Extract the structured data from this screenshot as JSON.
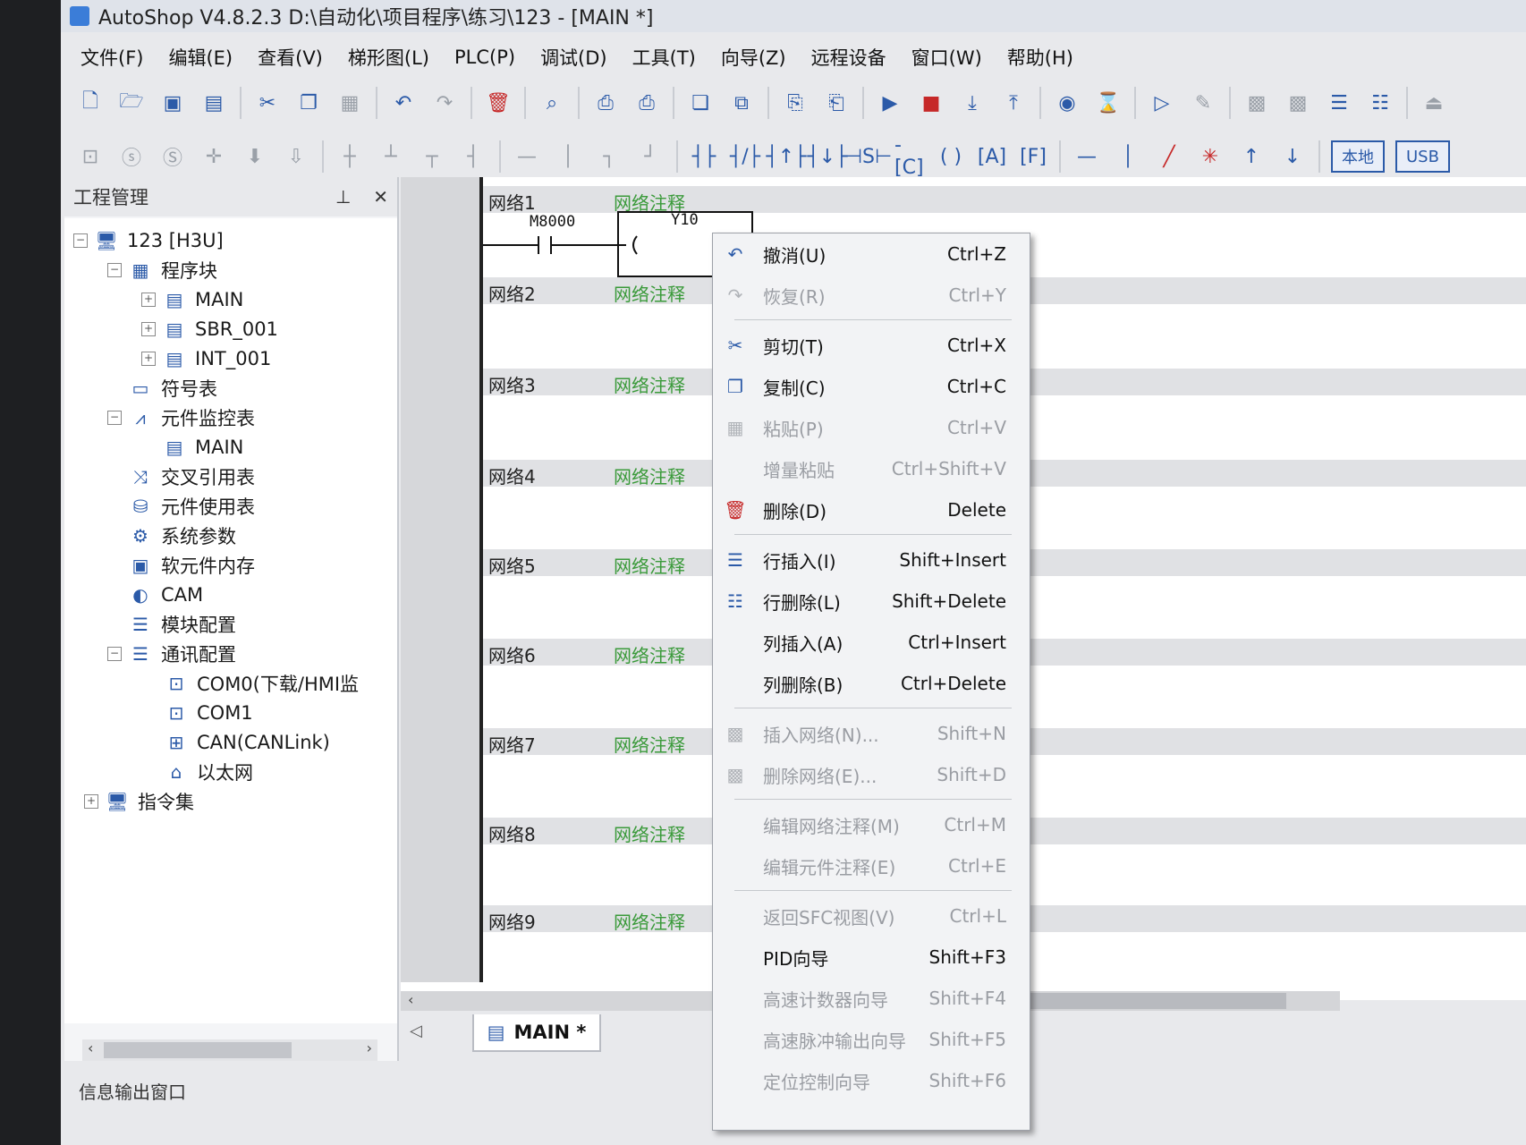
{
  "window": {
    "title": "AutoShop V4.8.2.3  D:\\自动化\\项目程序\\练习\\123 - [MAIN *]"
  },
  "menubar": [
    "文件(F)",
    "编辑(E)",
    "查看(V)",
    "梯形图(L)",
    "PLC(P)",
    "调试(D)",
    "工具(T)",
    "向导(Z)",
    "远程设备",
    "窗口(W)",
    "帮助(H)"
  ],
  "toolbar2_labels": {
    "local": "本地",
    "usb": "USB"
  },
  "project_panel": {
    "title": "工程管理",
    "tree": {
      "root": "123 [H3U]",
      "program_block": "程序块",
      "main": "MAIN",
      "sbr": "SBR_001",
      "int": "INT_001",
      "symbol_table": "符号表",
      "monitor_table": "元件监控表",
      "monitor_main": "MAIN",
      "cross_ref": "交叉引用表",
      "usage_table": "元件使用表",
      "sys_params": "系统参数",
      "soft_mem": "软元件内存",
      "cam": "CAM",
      "module_config": "模块配置",
      "comm_config": "通讯配置",
      "com0": "COM0(下载/HMI监",
      "com1": "COM1",
      "can": "CAN(CANLink)",
      "ethernet": "以太网",
      "instruction_set": "指令集"
    }
  },
  "info_window": "信息输出窗口",
  "ladder": {
    "networks": [
      "网络1",
      "网络2",
      "网络3",
      "网络4",
      "网络5",
      "网络6",
      "网络7",
      "网络8",
      "网络9"
    ],
    "comment": "网络注释",
    "contact": "M8000",
    "coil": "Y10"
  },
  "tab": {
    "label": "MAIN *"
  },
  "context_menu": [
    {
      "label": "撤消(U)",
      "key": "Ctrl+Z",
      "enabled": true
    },
    {
      "label": "恢复(R)",
      "key": "Ctrl+Y",
      "enabled": false
    },
    {
      "label": "剪切(T)",
      "key": "Ctrl+X",
      "enabled": true
    },
    {
      "label": "复制(C)",
      "key": "Ctrl+C",
      "enabled": true
    },
    {
      "label": "粘贴(P)",
      "key": "Ctrl+V",
      "enabled": false
    },
    {
      "label": "增量粘贴",
      "key": "Ctrl+Shift+V",
      "enabled": false
    },
    {
      "label": "删除(D)",
      "key": "Delete",
      "enabled": true
    },
    {
      "label": "行插入(I)",
      "key": "Shift+Insert",
      "enabled": true
    },
    {
      "label": "行删除(L)",
      "key": "Shift+Delete",
      "enabled": true
    },
    {
      "label": "列插入(A)",
      "key": "Ctrl+Insert",
      "enabled": true
    },
    {
      "label": "列删除(B)",
      "key": "Ctrl+Delete",
      "enabled": true
    },
    {
      "label": "插入网络(N)...",
      "key": "Shift+N",
      "enabled": false
    },
    {
      "label": "删除网络(E)...",
      "key": "Shift+D",
      "enabled": false
    },
    {
      "label": "编辑网络注释(M)",
      "key": "Ctrl+M",
      "enabled": false
    },
    {
      "label": "编辑元件注释(E)",
      "key": "Ctrl+E",
      "enabled": false
    },
    {
      "label": "返回SFC视图(V)",
      "key": "Ctrl+L",
      "enabled": false
    },
    {
      "label": "PID向导",
      "key": "Shift+F3",
      "enabled": true
    },
    {
      "label": "高速计数器向导",
      "key": "Shift+F4",
      "enabled": false
    },
    {
      "label": "高速脉冲输出向导",
      "key": "Shift+F5",
      "enabled": false
    },
    {
      "label": "定位控制向导",
      "key": "Shift+F6",
      "enabled": false
    }
  ]
}
